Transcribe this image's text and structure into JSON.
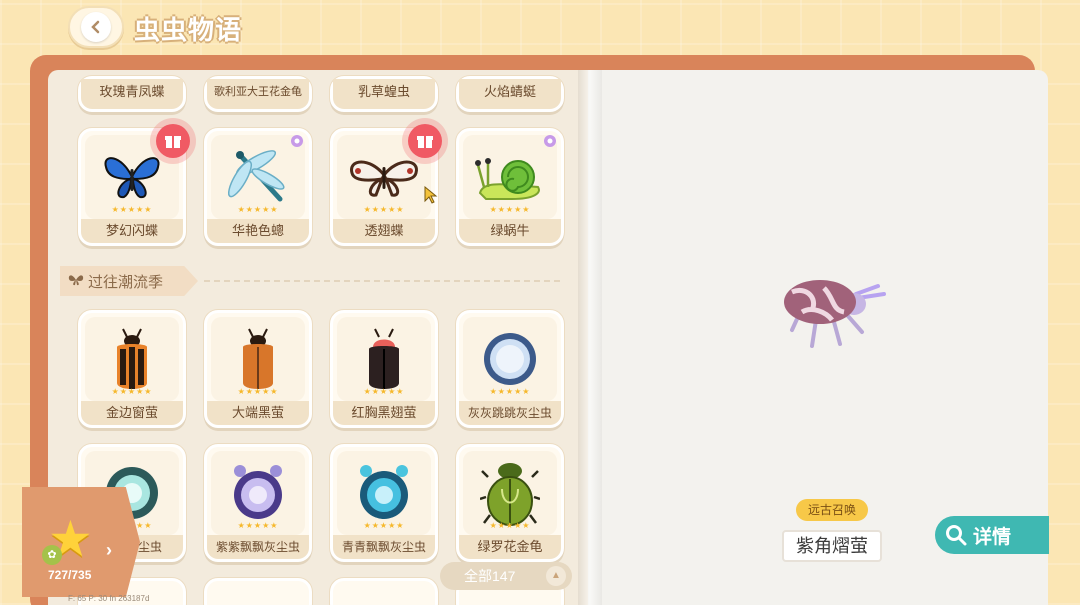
{
  "header": {
    "title": "虫虫物语"
  },
  "grid": {
    "row0": [
      "玫瑰青凤蝶",
      "歌利亚大王花金龟",
      "乳草蝗虫",
      "火焰蜻蜓"
    ],
    "row1": [
      "梦幻闪蝶",
      "华艳色蟌",
      "透翅蝶",
      "绿蜗牛"
    ],
    "section_label": "过往潮流季",
    "row2": [
      "金边窗萤",
      "大端黑萤",
      "红胸黑翅萤",
      "灰灰跳跳灰尘虫"
    ],
    "row3": [
      "跳跳灰尘虫",
      "紫紫飘飘灰尘虫",
      "青青飘飘灰尘虫",
      "绿罗花金龟"
    ],
    "stars": "★★★★★"
  },
  "detail": {
    "rarity_tag": "远古召唤",
    "insect_name": "紫角熠萤",
    "detail_button": "详情"
  },
  "progress": {
    "count": "727/735"
  },
  "filter": {
    "label": "全部147"
  },
  "debug": "F: 65   P: 30   fn 263187d",
  "colors": {
    "accent": "#3fb8b2",
    "gift": "#f05a64",
    "cover": "#d9845a",
    "star": "#ffd23a"
  }
}
